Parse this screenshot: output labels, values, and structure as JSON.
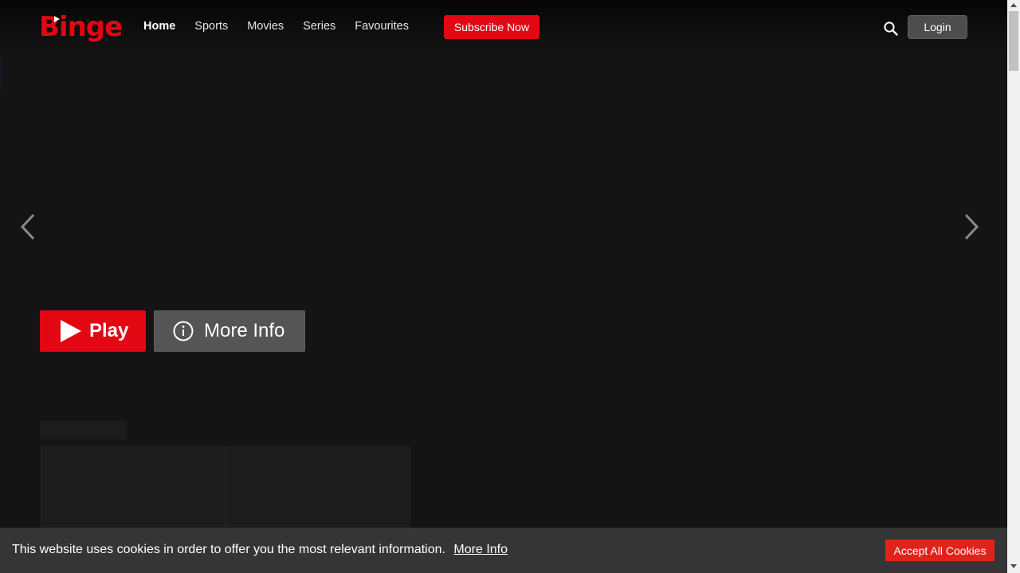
{
  "header": {
    "logo_text": "Binge",
    "nav_items": [
      "Home",
      "Sports",
      "Movies",
      "Series",
      "Favourites"
    ],
    "subscribe_label": "Subscribe Now",
    "login_label": "Login"
  },
  "hero": {
    "play_label": "Play",
    "more_info_label": "More Info"
  },
  "cookie": {
    "message": "This website uses cookies in order to offer you the most relevant information.",
    "more_info_link": "More Info",
    "accept_label": "Accept All Cookies"
  },
  "colors": {
    "brand_red": "#e30613",
    "background": "#141414",
    "cookie_bar": "#353535"
  },
  "icons": [
    "search-icon",
    "chevron-left-icon",
    "chevron-right-icon",
    "play-icon",
    "info-icon"
  ]
}
